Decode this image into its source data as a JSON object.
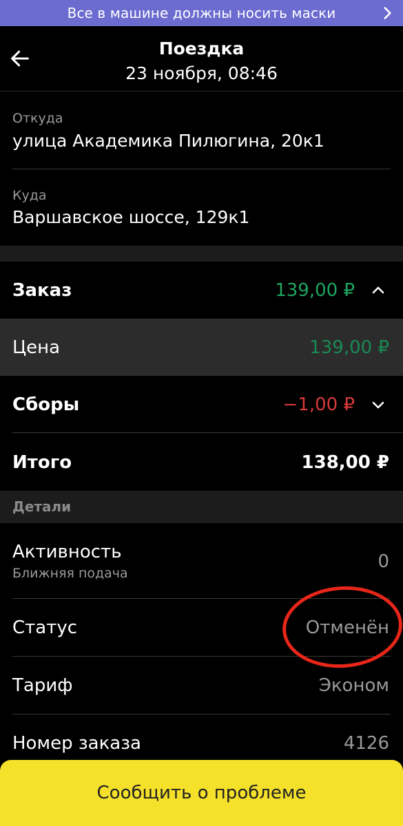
{
  "banner": {
    "text": "Все в машине должны носить маски"
  },
  "header": {
    "title": "Поездка",
    "subtitle": "23 ноября, 08:46"
  },
  "route": {
    "from_label": "Откуда",
    "from_value": "улица Академика Пилюгина, 20к1",
    "to_label": "Куда",
    "to_value": "Варшавское шоссе, 129к1"
  },
  "order": {
    "label": "Заказ",
    "amount": "139,00 ₽",
    "price_label": "Цена",
    "price_amount": "139,00 ₽",
    "fees_label": "Сборы",
    "fees_amount": "−1,00 ₽",
    "total_label": "Итого",
    "total_amount": "138,00 ₽"
  },
  "details": {
    "title": "Детали",
    "activity_label": "Активность",
    "activity_sub": "Ближняя подача",
    "activity_value": "0",
    "status_label": "Статус",
    "status_value": "Отменён",
    "tariff_label": "Тариф",
    "tariff_value": "Эконом",
    "order_number_label": "Номер заказа",
    "order_number_value": "4126"
  },
  "report_button": {
    "label": "Сообщить о проблеме"
  },
  "colors": {
    "banner": "#6b6bd0",
    "positive": "#1fa561",
    "price_positive": "#1a8a55",
    "negative": "#d63a3a",
    "highlight": "#2c2c2c",
    "button": "#f5e02a",
    "annotation": "#e8261a"
  }
}
